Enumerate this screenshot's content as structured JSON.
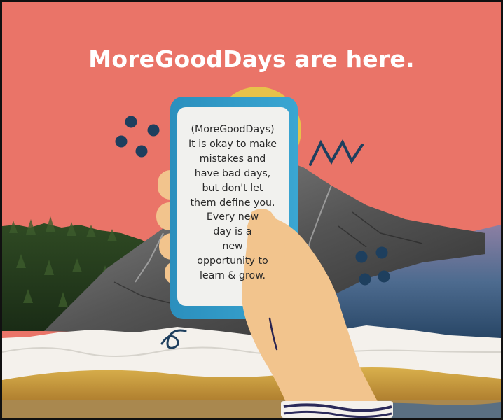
{
  "headline": "MoreGoodDays are here.",
  "phone_message_lines": [
    "(MoreGoodDays)",
    "It is okay to make",
    "mistakes and",
    "have bad days,",
    "but don't let",
    "them define you.",
    "Every new",
    "day is a",
    "new",
    "opportunity to",
    "learn & grow."
  ],
  "colors": {
    "background_coral": "#ea7468",
    "sun_yellow": "#e7c24a",
    "phone_frame_blue": "#2f9bc7",
    "phone_screen": "#f1f1ee",
    "hand_skin": "#f2c48d",
    "dots_navy": "#1e3f5e",
    "snow": "#f4f1ec",
    "sand_gold": "#c99a3c"
  }
}
